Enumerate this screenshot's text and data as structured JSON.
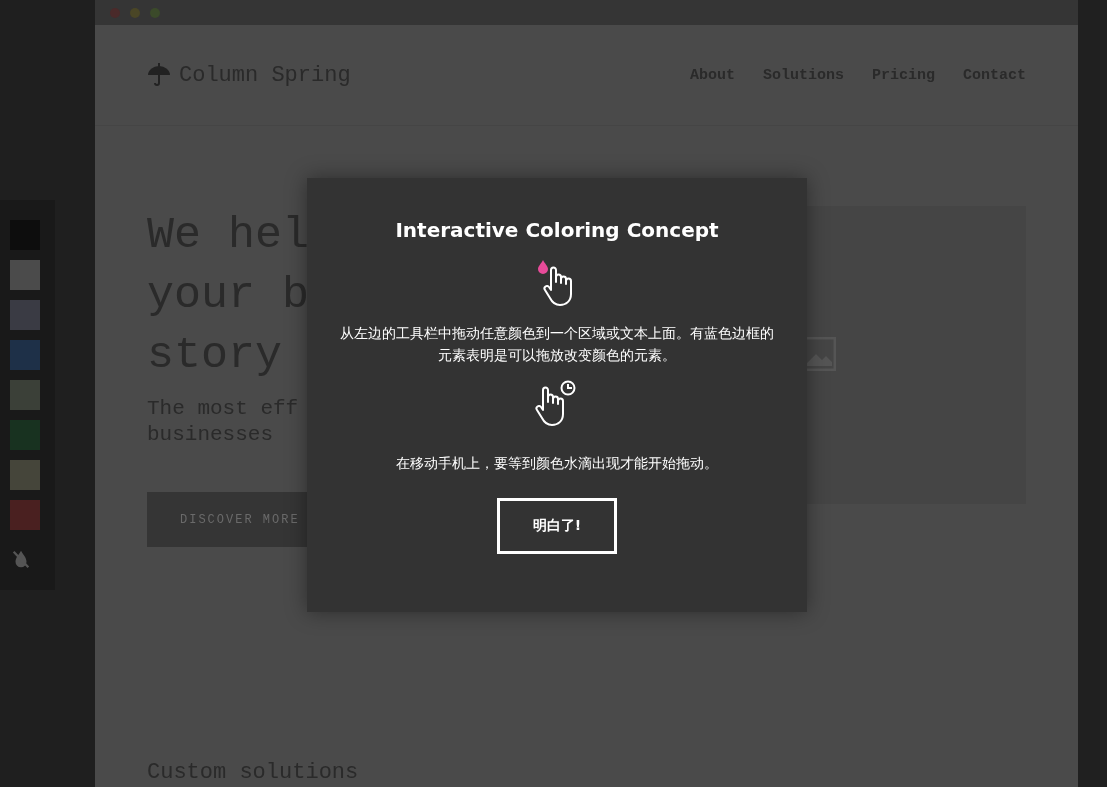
{
  "palette": [
    {
      "color": "#0d0d0d"
    },
    {
      "color": "#4b4b4b"
    },
    {
      "color": "#3a3b44"
    },
    {
      "color": "#1e3048"
    },
    {
      "color": "#3b4038"
    },
    {
      "color": "#183220"
    },
    {
      "color": "#45453a"
    },
    {
      "color": "#4a2020"
    }
  ],
  "site": {
    "logo": "Column Spring",
    "nav": [
      "About",
      "Solutions",
      "Pricing",
      "Contact"
    ],
    "hero": {
      "heading_lines": [
        "We hel",
        "your b",
        "story"
      ],
      "subtitle_lines": [
        "The most eff",
        "businesses"
      ],
      "button": "DISCOVER MORE"
    },
    "section_title": "Custom solutions"
  },
  "modal": {
    "title": "Interactive Coloring Concept",
    "step_1": "从左边的工具栏中拖动任意颜色到一个区域或文本上面。有蓝色边框的元素表明是可以拖放改变颜色的元素。",
    "step_2": "在移动手机上，要等到颜色水滴出现才能开始拖动。",
    "button": "明白了!"
  }
}
